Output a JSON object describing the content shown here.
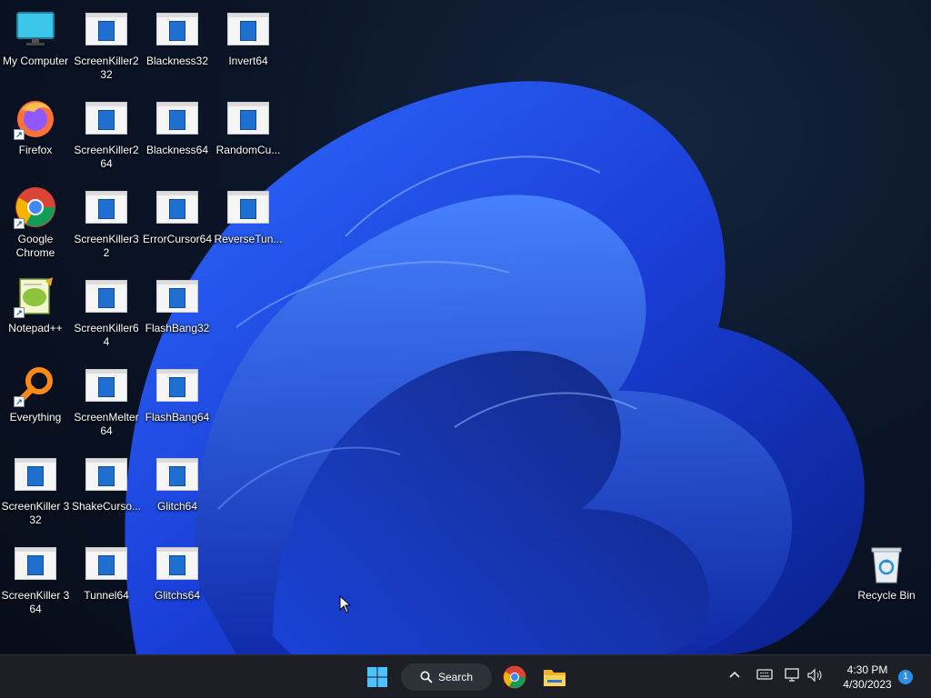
{
  "desktop": {
    "icons": [
      {
        "label": "My Computer",
        "icon": "monitor-icon"
      },
      {
        "label": "ScreenKiller2 32",
        "icon": "app-window-icon"
      },
      {
        "label": "Blackness32",
        "icon": "app-window-icon"
      },
      {
        "label": "Invert64",
        "icon": "app-window-icon"
      },
      {
        "label": "Firefox",
        "icon": "firefox-icon"
      },
      {
        "label": "ScreenKiller2 64",
        "icon": "app-window-icon"
      },
      {
        "label": "Blackness64",
        "icon": "app-window-icon"
      },
      {
        "label": "RandomCu...",
        "icon": "app-window-icon"
      },
      {
        "label": "Google Chrome",
        "icon": "chrome-icon"
      },
      {
        "label": "ScreenKiller32",
        "icon": "app-window-icon"
      },
      {
        "label": "ErrorCursor64",
        "icon": "app-window-icon"
      },
      {
        "label": "ReverseTun...",
        "icon": "app-window-icon"
      },
      {
        "label": "Notepad++",
        "icon": "notepad-plus-plus-icon"
      },
      {
        "label": "ScreenKiller64",
        "icon": "app-window-icon"
      },
      {
        "label": "FlashBang32",
        "icon": "app-window-icon"
      },
      {
        "label": "Everything",
        "icon": "magnifier-icon"
      },
      {
        "label": "ScreenMelter 64",
        "icon": "app-window-icon"
      },
      {
        "label": "FlashBang64",
        "icon": "app-window-icon"
      },
      {
        "label": "ScreenKiller 3 32",
        "icon": "app-window-icon"
      },
      {
        "label": "ShakeCurso...",
        "icon": "app-window-icon"
      },
      {
        "label": "Glitch64",
        "icon": "app-window-icon"
      },
      {
        "label": "ScreenKiller 3 64",
        "icon": "app-window-icon"
      },
      {
        "label": "Tunnel64",
        "icon": "app-window-icon"
      },
      {
        "label": "Glitchs64",
        "icon": "app-window-icon"
      },
      {
        "label": "Recycle Bin",
        "icon": "recycle-bin-icon"
      }
    ]
  },
  "taskbar": {
    "start_icon": "windows-logo-icon",
    "search_label": "Search",
    "pinned": [
      "chrome-icon",
      "file-explorer-icon"
    ],
    "tray": {
      "icons": [
        "chevron-up-icon",
        "keyboard-icon",
        "network-icon",
        "volume-icon"
      ],
      "time": "4:30 PM",
      "date": "4/30/2023",
      "notification_count": "1"
    }
  },
  "colors": {
    "accent": "#1e6fd0",
    "taskbar_bg": "#1c1f26",
    "desktop_bg": "#0b1528"
  }
}
